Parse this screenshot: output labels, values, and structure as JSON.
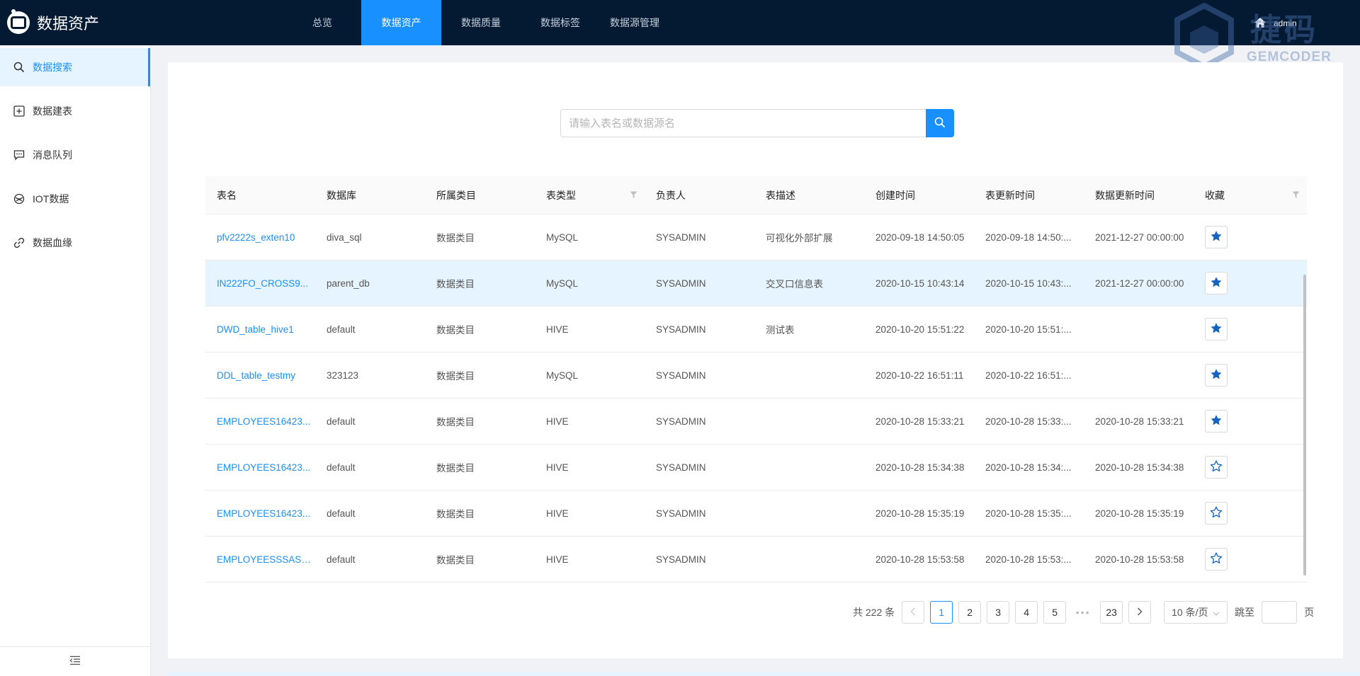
{
  "app": {
    "title": "数据资产",
    "user": "admin"
  },
  "watermark": {
    "main": "捷码",
    "sub": "GEMCODER"
  },
  "topnav": [
    {
      "label": "总览",
      "active": false
    },
    {
      "label": "数据资产",
      "active": true
    },
    {
      "label": "数据质量",
      "active": false
    },
    {
      "label": "数据标签",
      "active": false
    },
    {
      "label": "数据源管理",
      "active": false
    }
  ],
  "sidebar": {
    "items": [
      {
        "label": "数据搜索",
        "icon": "search-icon",
        "active": true
      },
      {
        "label": "数据建表",
        "icon": "plus-square-icon",
        "active": false
      },
      {
        "label": "消息队列",
        "icon": "message-icon",
        "active": false
      },
      {
        "label": "IOT数据",
        "icon": "iot-icon",
        "active": false
      },
      {
        "label": "数据血缘",
        "icon": "link-icon",
        "active": false
      }
    ],
    "collapse_icon": "menu-fold-icon"
  },
  "search": {
    "placeholder": "请输入表名或数据源名",
    "value": ""
  },
  "table": {
    "columns": [
      "表名",
      "数据库",
      "所属类目",
      "表类型",
      "负责人",
      "表描述",
      "创建时间",
      "表更新时间",
      "数据更新时间",
      "收藏"
    ],
    "rows": [
      {
        "name": "pfv2222s_exten10",
        "db": "diva_sql",
        "category": "数据类目",
        "type": "MySQL",
        "owner": "SYSADMIN",
        "desc": "可视化外部扩展",
        "created": "2020-09-18 14:50:05",
        "table_updated": "2020-09-18 14:50:...",
        "data_updated": "2021-12-27 00:00:00",
        "favorite": true
      },
      {
        "name": "IN222FO_CROSS9...",
        "db": "parent_db",
        "category": "数据类目",
        "type": "MySQL",
        "owner": "SYSADMIN",
        "desc": "交叉口信息表",
        "created": "2020-10-15 10:43:14",
        "table_updated": "2020-10-15 10:43:...",
        "data_updated": "2021-12-27 00:00:00",
        "favorite": true
      },
      {
        "name": "DWD_table_hive1",
        "db": "default",
        "category": "数据类目",
        "type": "HIVE",
        "owner": "SYSADMIN",
        "desc": "测试表",
        "created": "2020-10-20 15:51:22",
        "table_updated": "2020-10-20 15:51:...",
        "data_updated": "",
        "favorite": true
      },
      {
        "name": "DDL_table_testmy",
        "db": "323123",
        "category": "数据类目",
        "type": "MySQL",
        "owner": "SYSADMIN",
        "desc": "",
        "created": "2020-10-22 16:51:11",
        "table_updated": "2020-10-22 16:51:...",
        "data_updated": "",
        "favorite": true
      },
      {
        "name": "EMPLOYEES16423...",
        "db": "default",
        "category": "数据类目",
        "type": "HIVE",
        "owner": "SYSADMIN",
        "desc": "",
        "created": "2020-10-28 15:33:21",
        "table_updated": "2020-10-28 15:33:...",
        "data_updated": "2020-10-28 15:33:21",
        "favorite": true
      },
      {
        "name": "EMPLOYEES16423...",
        "db": "default",
        "category": "数据类目",
        "type": "HIVE",
        "owner": "SYSADMIN",
        "desc": "",
        "created": "2020-10-28 15:34:38",
        "table_updated": "2020-10-28 15:34:...",
        "data_updated": "2020-10-28 15:34:38",
        "favorite": false
      },
      {
        "name": "EMPLOYEES16423...",
        "db": "default",
        "category": "数据类目",
        "type": "HIVE",
        "owner": "SYSADMIN",
        "desc": "",
        "created": "2020-10-28 15:35:19",
        "table_updated": "2020-10-28 15:35:...",
        "data_updated": "2020-10-28 15:35:19",
        "favorite": false
      },
      {
        "name": "EMPLOYEESSSASS...",
        "db": "default",
        "category": "数据类目",
        "type": "HIVE",
        "owner": "SYSADMIN",
        "desc": "",
        "created": "2020-10-28 15:53:58",
        "table_updated": "2020-10-28 15:53:...",
        "data_updated": "2020-10-28 15:53:58",
        "favorite": false
      }
    ]
  },
  "pagination": {
    "total_text": "共 222 条",
    "pages": [
      "1",
      "2",
      "3",
      "4",
      "5"
    ],
    "current": "1",
    "ellipsis": "•••",
    "last_page": "23",
    "page_size": "10 条/页",
    "jump_label": "跳至",
    "jump_value": "",
    "page_unit": "页"
  },
  "colors": {
    "accent": "#1890ff",
    "header_bg": "#041a33",
    "star_filled": "#1565c0"
  }
}
